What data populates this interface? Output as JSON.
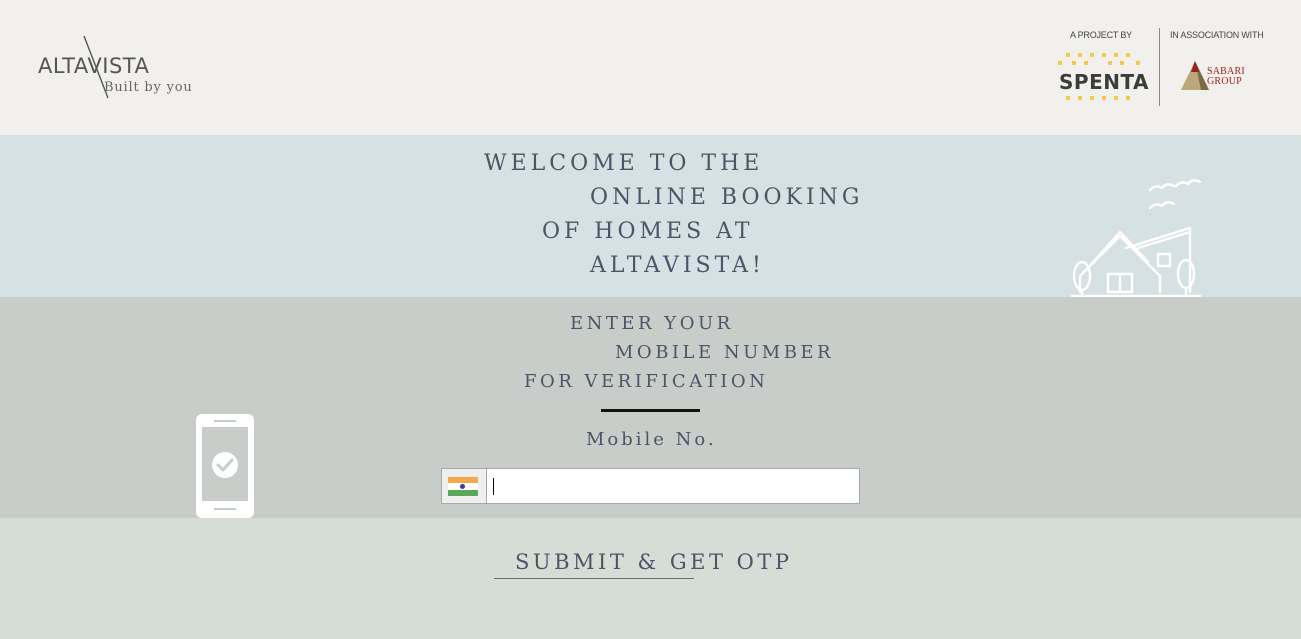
{
  "header": {
    "logo": {
      "name": "ALTAVISTA",
      "tagline": "Built by you",
      "icon": "altavista-slash-logo"
    },
    "partners": [
      {
        "caption": "A PROJECT BY",
        "name": "SPENTA",
        "icon": "spenta-dotted-logo",
        "accent": "#f2c94c"
      },
      {
        "caption": "IN ASSOCIATION WITH",
        "name": "SABARI GROUP",
        "icon": "sabari-pyramid-logo",
        "accent": "#a02020"
      }
    ]
  },
  "welcome": {
    "lines": [
      "WELCOME TO THE",
      "ONLINE BOOKING",
      "OF HOMES AT",
      "ALTAVISTA!"
    ],
    "illustration": "house-with-birds-illustration"
  },
  "verify": {
    "lines": [
      "ENTER YOUR",
      "MOBILE NUMBER",
      "FOR VERIFICATION"
    ],
    "mobile_label": "Mobile No.",
    "phone_input": {
      "value": "",
      "placeholder": ""
    },
    "country_flag": "india-flag-icon",
    "illustration": "phone-check-illustration"
  },
  "submit": {
    "label": "SUBMIT & GET OTP"
  },
  "colors": {
    "header_bg": "#f1f0ec",
    "welcome_bg": "#d5e1e2",
    "verify_bg": "#c9cdc9",
    "bottom_bg": "#d6ddd6",
    "text": "#4a5566"
  }
}
